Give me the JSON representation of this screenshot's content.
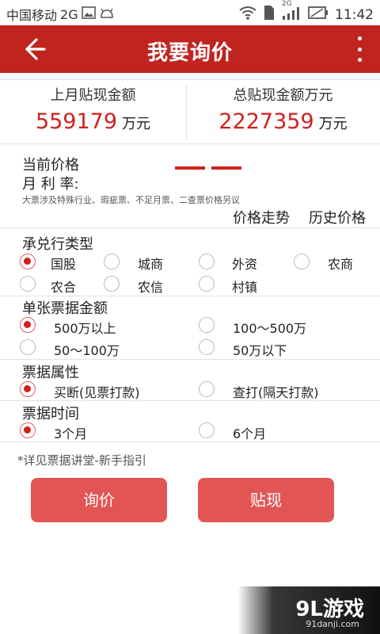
{
  "status_bar": {
    "carrier": "中国移动",
    "network": "2G",
    "network_small": "2G",
    "time": "11:42",
    "icons": [
      "image-icon",
      "android-icon",
      "wifi-icon",
      "sim-icon",
      "signal-icon",
      "battery-icon"
    ]
  },
  "app_bar": {
    "title": "我要询价",
    "back_icon": "back-arrow-icon",
    "menu_icon": "more-vertical-icon",
    "color": "#c1241f"
  },
  "summary": {
    "last_month_label": "上月贴现金额",
    "last_month_value": "559179",
    "last_month_unit": "万元",
    "total_label": "总贴现金额万元",
    "total_value": "2227359",
    "total_unit": "万元",
    "value_color": "#d0211c"
  },
  "price": {
    "current_price_label": "当前价格",
    "monthly_rate_label": "月 利 率:",
    "note": "大票涉及特殊行业、瑕疵票、不足月票、二查票价格另议",
    "trend_link": "价格走势",
    "history_link": "历史价格"
  },
  "bank_type": {
    "title": "承兑行类型",
    "options": [
      {
        "label": "国股",
        "selected": true
      },
      {
        "label": "城商",
        "selected": false
      },
      {
        "label": "外资",
        "selected": false
      },
      {
        "label": "农商",
        "selected": false
      },
      {
        "label": "农合",
        "selected": false
      },
      {
        "label": "农信",
        "selected": false
      },
      {
        "label": "村镇",
        "selected": false
      }
    ]
  },
  "amount": {
    "title": "单张票据金额",
    "options": [
      {
        "label": "500万以上",
        "selected": true
      },
      {
        "label": "100～500万",
        "selected": false
      },
      {
        "label": "50～100万",
        "selected": false
      },
      {
        "label": "50万以下",
        "selected": false
      }
    ]
  },
  "attribute": {
    "title": "票据属性",
    "options": [
      {
        "label": "买断(见票打款)",
        "selected": true
      },
      {
        "label": "查打(隔天打款)",
        "selected": false
      }
    ]
  },
  "duration": {
    "title": "票据时间",
    "options": [
      {
        "label": "3个月",
        "selected": true
      },
      {
        "label": "6个月",
        "selected": false
      }
    ]
  },
  "guide_text": "*详见票据讲堂-新手指引",
  "buttons": {
    "inquiry": "询价",
    "discount": "贴现",
    "color": "#e35555"
  },
  "watermark": {
    "brand": "9L游戏",
    "domain": "91danji.com"
  }
}
